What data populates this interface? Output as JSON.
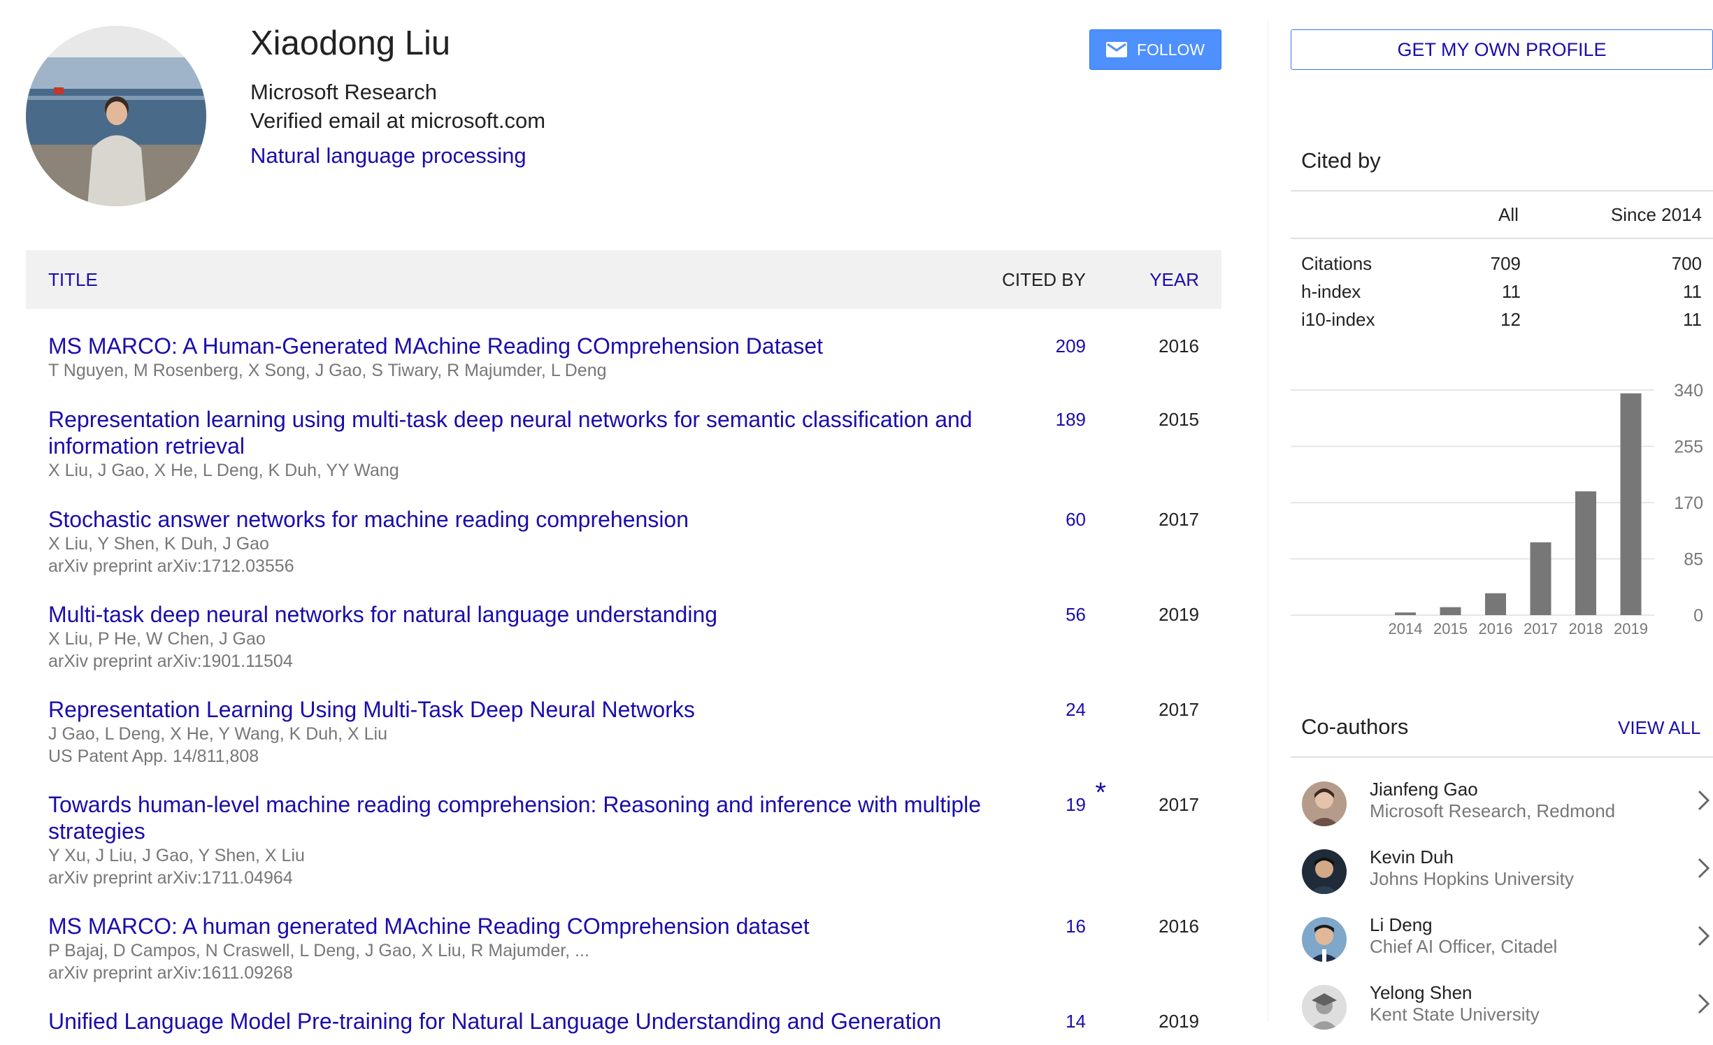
{
  "profile": {
    "name": "Xiaodong Liu",
    "affiliation": "Microsoft Research",
    "email": "Verified email at microsoft.com",
    "interest": "Natural language processing",
    "follow_label": "FOLLOW"
  },
  "table": {
    "headers": {
      "title": "TITLE",
      "cited_by": "CITED BY",
      "year": "YEAR"
    },
    "rows": [
      {
        "title": "MS MARCO: A Human-Generated MAchine Reading COmprehension Dataset",
        "authors": "T Nguyen, M Rosenberg, X Song, J Gao, S Tiwary, R Majumder, L Deng",
        "venue": "",
        "cited": "209",
        "star": "",
        "year": "2016"
      },
      {
        "title": "Representation learning using multi-task deep neural networks for semantic classification and information retrieval",
        "authors": "X Liu, J Gao, X He, L Deng, K Duh, YY Wang",
        "venue": "",
        "cited": "189",
        "star": "",
        "year": "2015"
      },
      {
        "title": "Stochastic answer networks for machine reading comprehension",
        "authors": "X Liu, Y Shen, K Duh, J Gao",
        "venue": "arXiv preprint arXiv:1712.03556",
        "cited": "60",
        "star": "",
        "year": "2017"
      },
      {
        "title": "Multi-task deep neural networks for natural language understanding",
        "authors": "X Liu, P He, W Chen, J Gao",
        "venue": "arXiv preprint arXiv:1901.11504",
        "cited": "56",
        "star": "",
        "year": "2019"
      },
      {
        "title": "Representation Learning Using Multi-Task Deep Neural Networks",
        "authors": "J Gao, L Deng, X He, Y Wang, K Duh, X Liu",
        "venue": "US Patent App. 14/811,808",
        "cited": "24",
        "star": "",
        "year": "2017"
      },
      {
        "title": "Towards human-level machine reading comprehension: Reasoning and inference with multiple strategies",
        "authors": "Y Xu, J Liu, J Gao, Y Shen, X Liu",
        "venue": "arXiv preprint arXiv:1711.04964",
        "cited": "19",
        "star": "*",
        "year": "2017"
      },
      {
        "title": "MS MARCO: A human generated MAchine Reading COmprehension dataset",
        "authors": "P Bajaj, D Campos, N Craswell, L Deng, J Gao, X Liu, R Majumder, ...",
        "venue": "arXiv preprint arXiv:1611.09268",
        "cited": "16",
        "star": "",
        "year": "2016"
      },
      {
        "title": "Unified Language Model Pre-training for Natural Language Understanding and Generation",
        "authors": "",
        "venue": "",
        "cited": "14",
        "star": "",
        "year": "2019"
      }
    ]
  },
  "sidebar": {
    "get_profile_label": "GET MY OWN PROFILE",
    "cited_by": {
      "title": "Cited by",
      "col_all": "All",
      "col_since": "Since 2014",
      "stats": [
        {
          "label": "Citations",
          "all": "709",
          "since": "700"
        },
        {
          "label": "h-index",
          "all": "11",
          "since": "11"
        },
        {
          "label": "i10-index",
          "all": "12",
          "since": "11"
        }
      ]
    },
    "coauthors": {
      "title": "Co-authors",
      "view_all": "VIEW ALL",
      "items": [
        {
          "name": "Jianfeng Gao",
          "affiliation": "Microsoft Research, Redmond"
        },
        {
          "name": "Kevin Duh",
          "affiliation": "Johns Hopkins University"
        },
        {
          "name": "Li Deng",
          "affiliation": "Chief AI Officer, Citadel"
        },
        {
          "name": "Yelong Shen",
          "affiliation": "Kent State University"
        }
      ]
    }
  },
  "colors": {
    "link": "#1a0dab",
    "follow_button": "#4d90fe",
    "bar": "#777777"
  },
  "chart_data": {
    "type": "bar",
    "categories": [
      "2014",
      "2015",
      "2016",
      "2017",
      "2018",
      "2019"
    ],
    "values": [
      4,
      12,
      33,
      110,
      187,
      335
    ],
    "ylim": [
      0,
      340
    ],
    "yticks": [
      "0",
      "85",
      "170",
      "255",
      "340"
    ],
    "grid": true
  }
}
